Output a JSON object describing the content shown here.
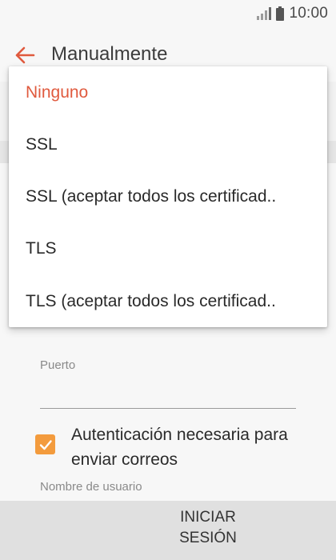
{
  "status_bar": {
    "time": "10:00",
    "icons": [
      "signal-icon",
      "battery-icon"
    ]
  },
  "app_bar": {
    "title": "Manualmente",
    "back_icon": "back-arrow-icon"
  },
  "form": {
    "port_label": "Puerto",
    "port_value": "",
    "auth_label": "Autenticación necesaria para enviar correos",
    "auth_checked": true,
    "username_label": "Nombre de usuario"
  },
  "security_dropdown": {
    "options": [
      "Ninguno",
      "SSL",
      "SSL (aceptar todos los certificad..",
      "TLS",
      "TLS (aceptar todos los certificad.."
    ],
    "selected": "Ninguno"
  },
  "footer": {
    "sign_in_label": "INICIAR\nSESIÓN"
  },
  "colors": {
    "accent": "#e05a3e",
    "checkbox": "#f39b3d"
  }
}
